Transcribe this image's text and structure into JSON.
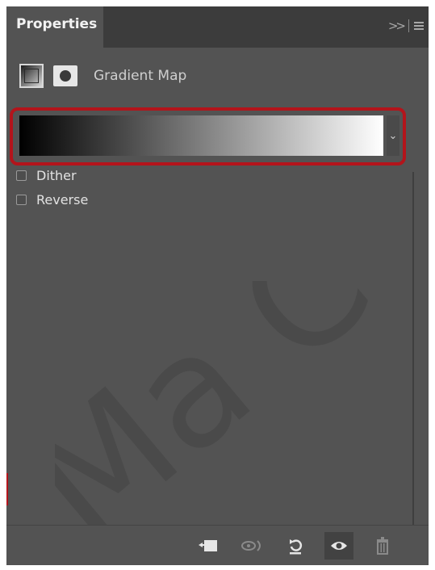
{
  "panel": {
    "tab_title": "Properties",
    "header_label": "Gradient Map"
  },
  "gradient": {
    "start_color": "#000000",
    "end_color": "#ffffff",
    "highlight_color": "#b3141b"
  },
  "options": {
    "dither_label": "Dither",
    "dither_checked": false,
    "reverse_label": "Reverse",
    "reverse_checked": false
  },
  "footer": {
    "icons": [
      "clip-to-layer-icon",
      "view-previous-state-icon",
      "reset-icon",
      "visibility-eye-icon",
      "trash-icon"
    ]
  },
  "watermark": {
    "text": "Ma C"
  },
  "colors": {
    "panel_bg": "#535353",
    "tabbar_bg": "#3c3c3c",
    "accent_red": "#b3141b"
  }
}
